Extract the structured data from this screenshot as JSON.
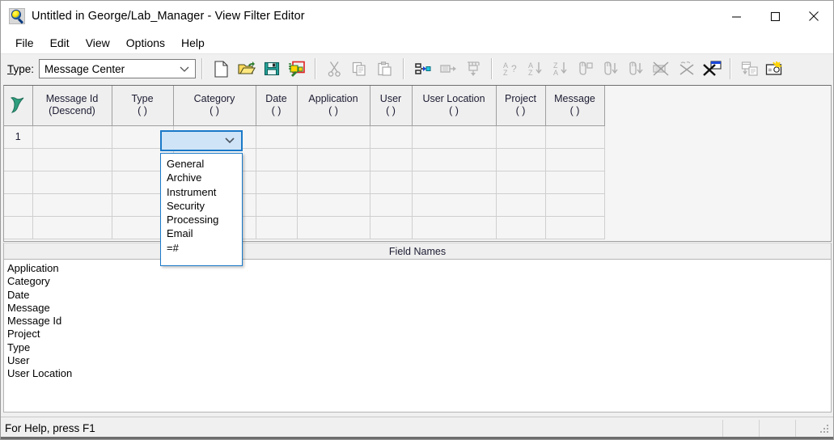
{
  "window": {
    "title": "Untitled in George/Lab_Manager - View Filter Editor",
    "icon": "magnifier-icon",
    "controls": {
      "minimize": "minimize-icon",
      "maximize": "maximize-icon",
      "close": "close-icon"
    }
  },
  "menubar": {
    "items": [
      {
        "label": "File"
      },
      {
        "label": "Edit"
      },
      {
        "label": "View"
      },
      {
        "label": "Options"
      },
      {
        "label": "Help"
      }
    ]
  },
  "toolbar": {
    "type_label": "Type:",
    "type_value": "Message Center",
    "type_options": [
      "Message Center"
    ],
    "buttons": [
      {
        "name": "new-icon",
        "title": "New"
      },
      {
        "name": "open-icon",
        "title": "Open"
      },
      {
        "name": "save-icon",
        "title": "Save"
      },
      {
        "name": "export-icon",
        "title": "Export"
      },
      {
        "name": "cut-icon",
        "title": "Cut"
      },
      {
        "name": "copy-icon",
        "title": "Copy"
      },
      {
        "name": "paste-icon",
        "title": "Paste"
      },
      {
        "name": "insert-row-icon",
        "title": "Insert Row"
      },
      {
        "name": "append-row-icon",
        "title": "Append Row"
      },
      {
        "name": "delete-row-icon",
        "title": "Delete Row"
      },
      {
        "name": "sort-az-query-icon",
        "title": "Sort"
      },
      {
        "name": "sort-az-down-icon",
        "title": "Sort Ascending"
      },
      {
        "name": "sort-za-down-icon",
        "title": "Sort Descending"
      },
      {
        "name": "group-icon",
        "title": "Group"
      },
      {
        "name": "group-down-icon",
        "title": "Group Down"
      },
      {
        "name": "group-down-alt-icon",
        "title": "Group Down Alt"
      },
      {
        "name": "clear-filter-icon",
        "title": "Clear Filter"
      },
      {
        "name": "clear-sort-icon",
        "title": "Clear Sort"
      },
      {
        "name": "clear-all-icon",
        "title": "Clear All"
      },
      {
        "name": "copy-layout-icon",
        "title": "Copy Layout"
      },
      {
        "name": "preview-icon",
        "title": "Preview"
      }
    ]
  },
  "grid": {
    "corner_icon": "filter-funnel-icon",
    "columns": [
      {
        "name": "Message Id",
        "sub": "(Descend)"
      },
      {
        "name": "Type",
        "sub": "( )"
      },
      {
        "name": "Category",
        "sub": "( )"
      },
      {
        "name": "Date",
        "sub": "( )"
      },
      {
        "name": "Application",
        "sub": "( )"
      },
      {
        "name": "User",
        "sub": "( )"
      },
      {
        "name": "User Location",
        "sub": "( )"
      },
      {
        "name": "Project",
        "sub": "( )"
      },
      {
        "name": "Message",
        "sub": "( )"
      }
    ],
    "rows": [
      {
        "num": "1",
        "cells": [
          "",
          "",
          "",
          "",
          "",
          "",
          "",
          "",
          ""
        ]
      },
      {
        "num": "",
        "cells": [
          "",
          "",
          "",
          "",
          "",
          "",
          "",
          "",
          ""
        ]
      },
      {
        "num": "",
        "cells": [
          "",
          "",
          "",
          "",
          "",
          "",
          "",
          "",
          ""
        ]
      },
      {
        "num": "",
        "cells": [
          "",
          "",
          "",
          "",
          "",
          "",
          "",
          "",
          ""
        ]
      },
      {
        "num": "",
        "cells": [
          "",
          "",
          "",
          "",
          "",
          "",
          "",
          "",
          ""
        ]
      }
    ]
  },
  "cell_editor": {
    "value": "",
    "arrow_icon": "chevron-down-icon",
    "options": [
      "General",
      "Archive",
      "Instrument",
      "Security",
      "Processing",
      "Email",
      "=#"
    ]
  },
  "field_panel": {
    "header": "Field Names",
    "fields": [
      "Application",
      "Category",
      "Date",
      "Message",
      "Message Id",
      "Project",
      "Type",
      "User",
      "User Location"
    ]
  },
  "statusbar": {
    "message": "For Help, press F1",
    "segments": [
      "",
      "",
      ""
    ],
    "grip": "resize-grip-icon"
  },
  "colors": {
    "accent": "#1a79c8",
    "cell_selected_bg": "#cfe4f7",
    "chrome": "#f0f0f0",
    "header": "#efefef",
    "text": "#1c1c33"
  }
}
